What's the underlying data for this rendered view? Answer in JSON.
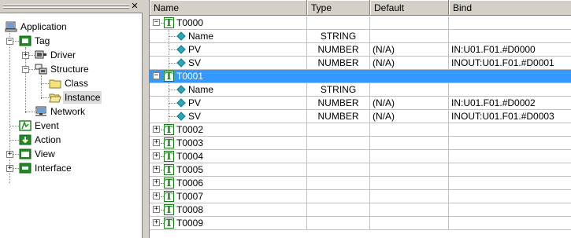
{
  "close_label": "✕",
  "tree": [
    {
      "label": "Application",
      "icon": "application-icon"
    },
    {
      "label": "Tag",
      "icon": "tag-icon",
      "expander": "−"
    },
    {
      "label": "Driver",
      "icon": "driver-icon",
      "expander": "+"
    },
    {
      "label": "Structure",
      "icon": "structure-icon",
      "expander": "−"
    },
    {
      "label": "Class",
      "icon": "folder-icon"
    },
    {
      "label": "Instance",
      "icon": "folder-open-icon",
      "selected": true
    },
    {
      "label": "Network",
      "icon": "network-icon"
    },
    {
      "label": "Event",
      "icon": "event-icon"
    },
    {
      "label": "Action",
      "icon": "action-icon"
    },
    {
      "label": "View",
      "icon": "view-icon",
      "expander": "+"
    },
    {
      "label": "Interface",
      "icon": "interface-icon",
      "expander": "+"
    }
  ],
  "columns": [
    "Name",
    "Type",
    "Default",
    "Bind"
  ],
  "rows": [
    {
      "kind": "instance",
      "expander": "−",
      "name": "T0000",
      "type": "",
      "default": "",
      "bind": ""
    },
    {
      "kind": "member",
      "name": "Name",
      "type": "STRING",
      "default": "",
      "bind": ""
    },
    {
      "kind": "member",
      "name": "PV",
      "type": "NUMBER",
      "default": "(N/A)",
      "bind": "IN:U01.F01.#D0000"
    },
    {
      "kind": "member",
      "name": "SV",
      "type": "NUMBER",
      "default": "(N/A)",
      "bind": "INOUT:U01.F01.#D0001"
    },
    {
      "kind": "instance",
      "expander": "−",
      "name": "T0001",
      "type": "",
      "default": "",
      "bind": "",
      "selected": true
    },
    {
      "kind": "member",
      "name": "Name",
      "type": "STRING",
      "default": "",
      "bind": ""
    },
    {
      "kind": "member",
      "name": "PV",
      "type": "NUMBER",
      "default": "(N/A)",
      "bind": "IN:U01.F01.#D0002"
    },
    {
      "kind": "member",
      "name": "SV",
      "type": "NUMBER",
      "default": "(N/A)",
      "bind": "INOUT:U01.F01.#D0003"
    },
    {
      "kind": "instance",
      "expander": "+",
      "name": "T0002",
      "type": "",
      "default": "",
      "bind": ""
    },
    {
      "kind": "instance",
      "expander": "+",
      "name": "T0003",
      "type": "",
      "default": "",
      "bind": ""
    },
    {
      "kind": "instance",
      "expander": "+",
      "name": "T0004",
      "type": "",
      "default": "",
      "bind": ""
    },
    {
      "kind": "instance",
      "expander": "+",
      "name": "T0005",
      "type": "",
      "default": "",
      "bind": ""
    },
    {
      "kind": "instance",
      "expander": "+",
      "name": "T0006",
      "type": "",
      "default": "",
      "bind": ""
    },
    {
      "kind": "instance",
      "expander": "+",
      "name": "T0007",
      "type": "",
      "default": "",
      "bind": ""
    },
    {
      "kind": "instance",
      "expander": "+",
      "name": "T0008",
      "type": "",
      "default": "",
      "bind": ""
    },
    {
      "kind": "instance",
      "expander": "+",
      "name": "T0009",
      "type": "",
      "default": "",
      "bind": ""
    }
  ],
  "instance_icon_letter": "T"
}
